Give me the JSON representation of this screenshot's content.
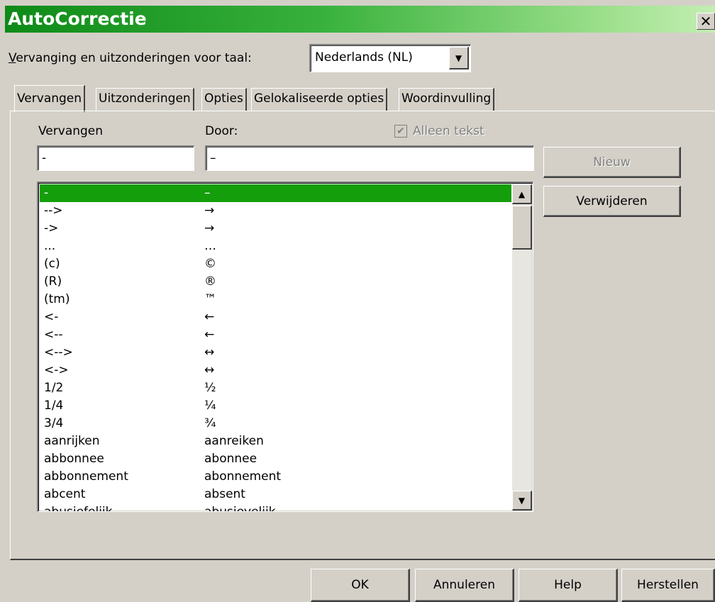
{
  "window": {
    "title": "AutoCorrectie",
    "close": "✕"
  },
  "language": {
    "label": "Vervanging en uitzonderingen voor taal:",
    "value": "Nederlands (NL)"
  },
  "tabs": [
    "Vervangen",
    "Uitzonderingen",
    "Opties",
    "Gelokaliseerde opties",
    "Woordinvulling"
  ],
  "form": {
    "replace_label": "Vervangen",
    "with_label": "Door:",
    "text_only_label": "Alleen tekst",
    "replace_value": "-",
    "with_value": "–"
  },
  "buttons": {
    "new": "Nieuw",
    "delete": "Verwijderen",
    "ok": "OK",
    "cancel": "Annuleren",
    "help": "Help",
    "reset": "Herstellen"
  },
  "entries": [
    [
      "-",
      "–"
    ],
    [
      "-->",
      "→"
    ],
    [
      "->",
      "→"
    ],
    [
      "...",
      "…"
    ],
    [
      "(c)",
      "©"
    ],
    [
      "(R)",
      "®"
    ],
    [
      "(tm)",
      "™"
    ],
    [
      "<-",
      "←"
    ],
    [
      "<--",
      "←"
    ],
    [
      "<-->",
      "↔"
    ],
    [
      "<->",
      "↔"
    ],
    [
      "1/2",
      "½"
    ],
    [
      "1/4",
      "¼"
    ],
    [
      "3/4",
      "¾"
    ],
    [
      "aanrijken",
      "aanreiken"
    ],
    [
      "abbonnee",
      "abonnee"
    ],
    [
      "abbonnement",
      "abonnement"
    ],
    [
      "abcent",
      "absent"
    ],
    [
      "abusiefelijk",
      "abusievelijk"
    ]
  ]
}
